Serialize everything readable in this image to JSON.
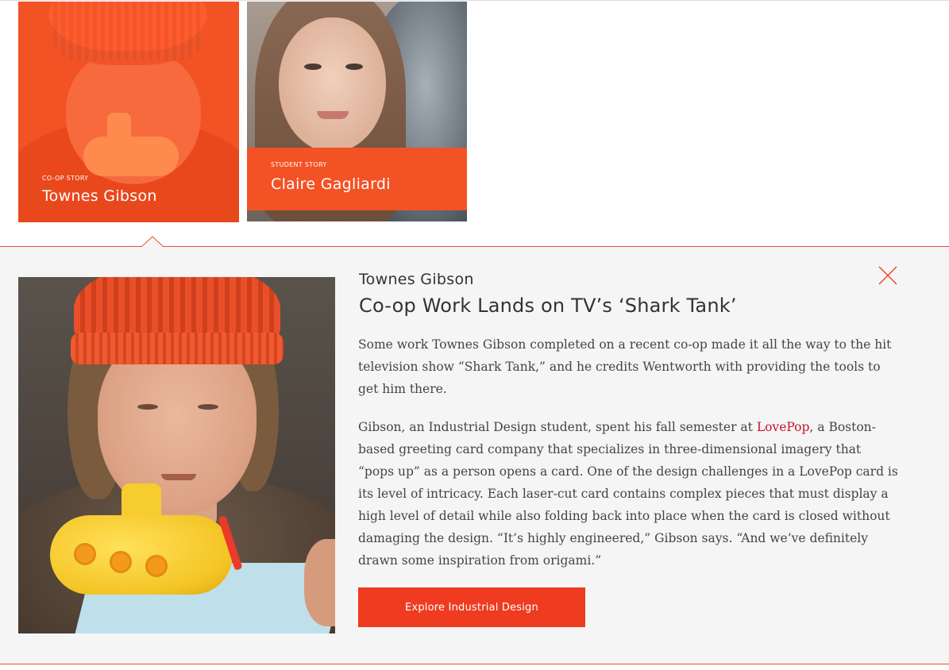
{
  "stories": [
    {
      "type": "Co-op Story",
      "name": "Townes Gibson"
    },
    {
      "type": "Student Story",
      "name": "Claire Gagliardi"
    }
  ],
  "detail": {
    "name": "Townes Gibson",
    "title": "Co-op Work Lands on TV’s ‘Shark Tank’",
    "paragraph1": "Some work Townes Gibson completed on a recent co-op made it all the way to the hit television show “Shark Tank,” and he credits Wentworth with providing the tools to get him there.",
    "paragraph2_before": "Gibson, an Industrial Design student, spent his fall semester at ",
    "paragraph2_link": "LovePop",
    "paragraph2_after": ", a Boston-based greeting card company that specializes in three-dimensional imagery that “pops up” as a person opens a card. One of the design challenges in a LovePop card is its level of intricacy. Each laser-cut card contains complex pieces that must display a high level of detail while also folding back into place when the card is closed without damaging the design. “It’s highly engineered,” Gibson says. “And we’ve definitely drawn some inspiration from origami.”",
    "cta_label": "Explore Industrial Design"
  },
  "colors": {
    "accent": "#f35224",
    "link": "#c8102e",
    "panel_bg": "#f5f5f5"
  },
  "icons": {
    "close": "close-icon",
    "pointer": "caret-up-icon"
  }
}
